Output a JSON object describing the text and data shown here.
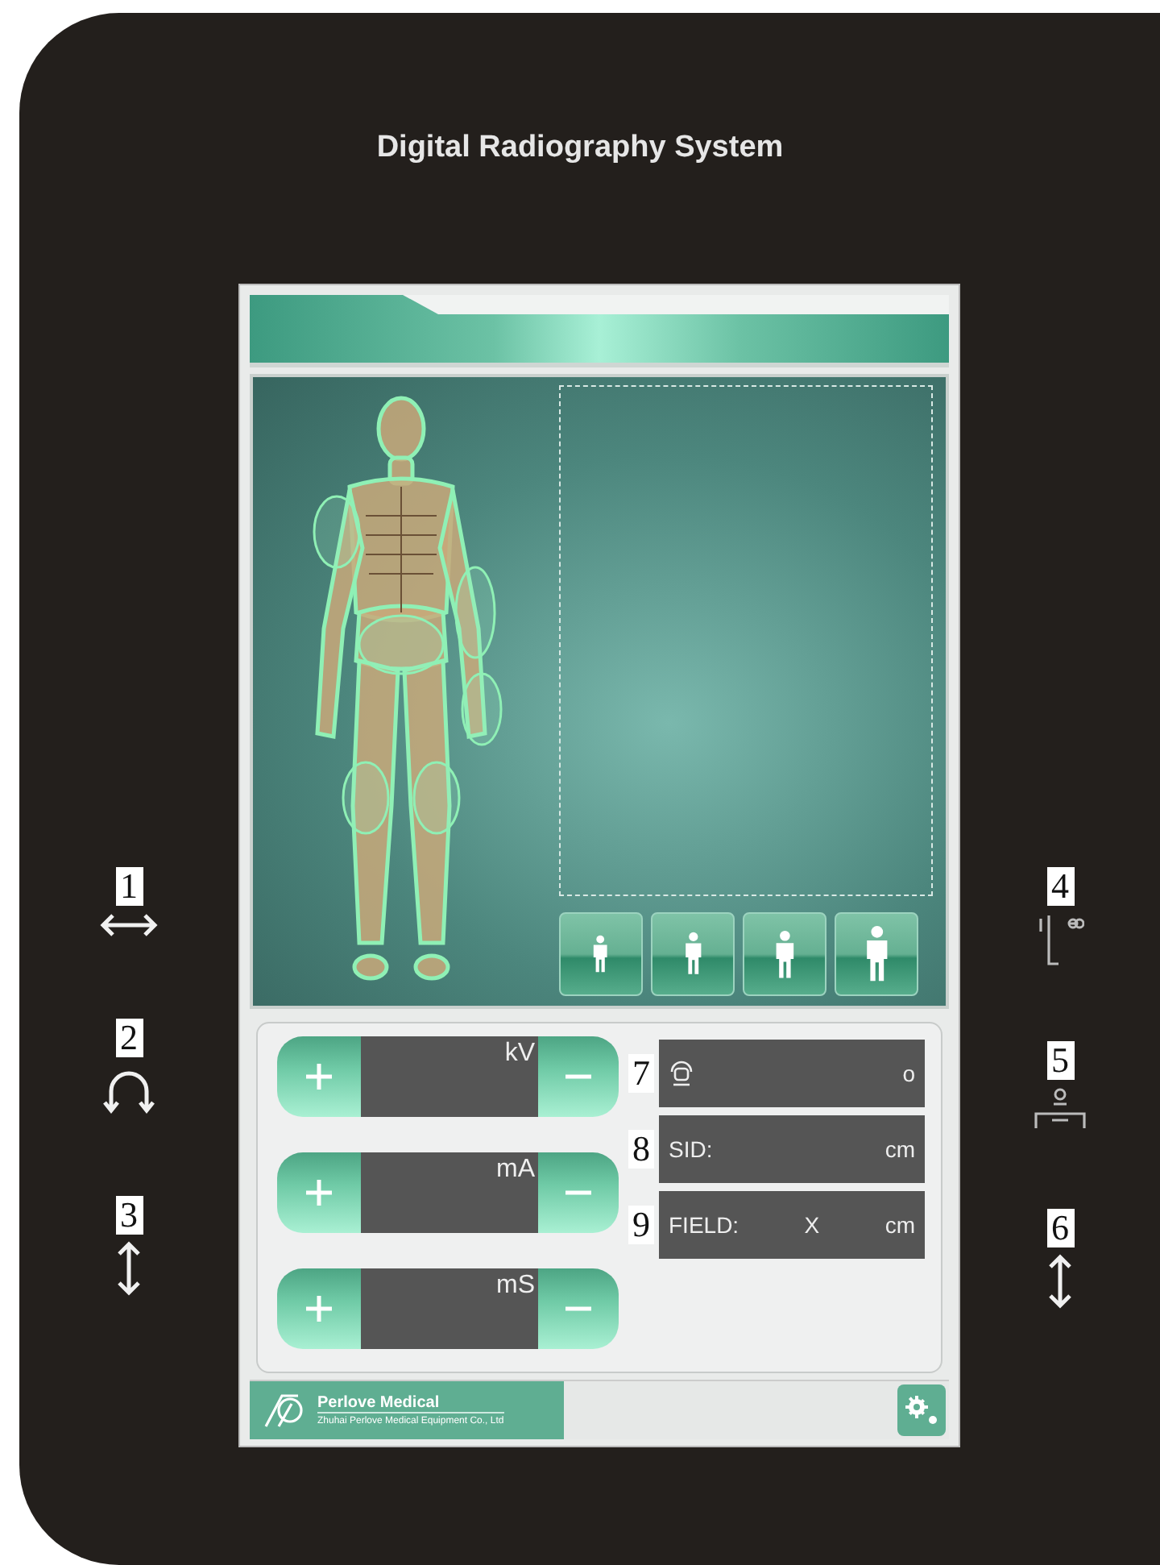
{
  "device": {
    "title": "Digital Radiography System"
  },
  "left_controls": [
    {
      "number": "1",
      "kind": "horizontal"
    },
    {
      "number": "2",
      "kind": "rotate"
    },
    {
      "number": "3",
      "kind": "vertical"
    }
  ],
  "right_controls": [
    {
      "number": "4",
      "kind": "detector"
    },
    {
      "number": "5",
      "kind": "table"
    },
    {
      "number": "6",
      "kind": "vertical"
    }
  ],
  "body_sizes": [
    {
      "kind": "xsmall"
    },
    {
      "kind": "small"
    },
    {
      "kind": "medium"
    },
    {
      "kind": "large"
    }
  ],
  "parameters": [
    {
      "unit": "kV"
    },
    {
      "unit": "mA"
    },
    {
      "unit": "mS"
    }
  ],
  "readouts": [
    {
      "number": "7",
      "kind": "angle",
      "unit": "o"
    },
    {
      "number": "8",
      "kind": "sid",
      "label": "SID:",
      "unit": "cm"
    },
    {
      "number": "9",
      "kind": "field",
      "label": "FIELD:",
      "separator": "X",
      "unit": "cm"
    }
  ],
  "footer": {
    "company": "Perlove Medical",
    "subtitle": "Zhuhai Perlove Medical Equipment Co., Ltd"
  }
}
